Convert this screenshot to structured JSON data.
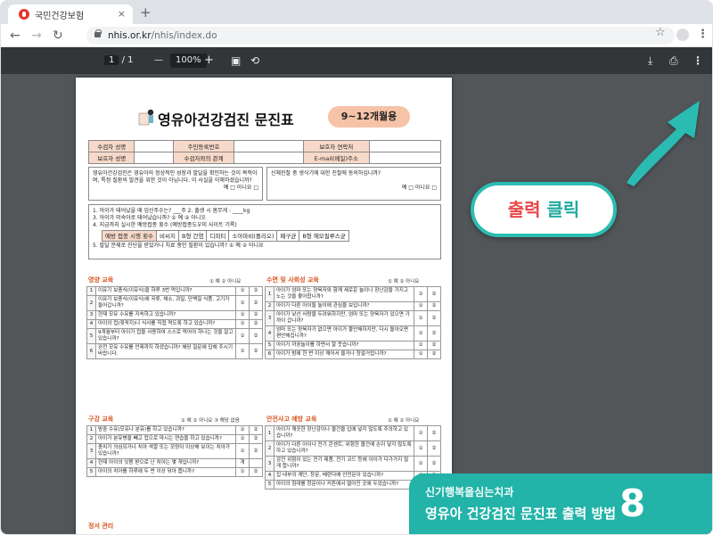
{
  "browser": {
    "tab_title": "국민건강보험",
    "tab_close": "×",
    "new_tab": "+",
    "url_domain": "nhis.or.kr",
    "url_path": "/nhis/index.do",
    "icons": [
      "back-icon",
      "forward-icon",
      "reload-icon",
      "lock-icon",
      "star-icon",
      "profile-icon",
      "menu-icon"
    ]
  },
  "pdf_viewer": {
    "page_current": "1",
    "page_sep": "/",
    "page_total": "1",
    "zoom": "100%",
    "zoom_out": "—",
    "zoom_in": "+",
    "icons": [
      "fit-page-icon",
      "rotate-icon",
      "download-icon",
      "print-icon",
      "more-icon"
    ]
  },
  "document": {
    "title": "영유아건강검진 문진표",
    "age_badge": "9~12개월용",
    "info": {
      "row1": [
        "수검자 성명",
        "",
        "주민등록번호",
        "",
        "보호자 연락처",
        ""
      ],
      "row2": [
        "보호자 성명",
        "",
        "수검자와의 관계",
        "",
        "E-mail(메일)주소",
        ""
      ]
    },
    "consent_left": "영유아건강검진은 영유아의 정상적인 성장과 발달을 확인하는 것이 목적이며, 특정 질환의 발견을 위한 것이 아닙니다. 이 사실을 이해하셨습니까?",
    "consent_left_opts": "예 □   아니요 □",
    "consent_right": "신체진찰 중 생식기에 대한 진찰에 동의하십니까?",
    "consent_right_opts": "예 □   아니요 □",
    "birth_lines": [
      "1. 아이가 태어났을 때 임신주수는? ___주   2. 출생 시 몸무게 : ____kg",
      "3. 아이가 미숙아로 태어났습니까? ① 예  ② 아니오",
      "4. 지금까지 실시한 예방접종 횟수 (예방접종도우미 사이트 기록)",
      "5. 발달 문제로 진단을 받았거나 치료 중인 질환이 있습니까? ① 예  ② 아니요"
    ],
    "vaccines": [
      "비씨지",
      "B형 간염",
      "디피티",
      "소아마비(폴리오)",
      "폐구균",
      "B형 헤모필루스균"
    ],
    "vaccine_label": "예방 접종 시행 횟수",
    "nutrition": {
      "title": "영양 교육",
      "rate": "① 예  ② 아니요",
      "rows": [
        {
          "n": "1",
          "q": "이유기 보충식(이유식)을 하루 3번 먹입니까?",
          "a": "①",
          "b": "②"
        },
        {
          "n": "2",
          "q": "이유기 보충식(이유식)에 곡류, 채소, 과일, 단백질 식품, 고기가 들어갑니까?",
          "a": "①",
          "b": "②"
        },
        {
          "n": "3",
          "q": "현재 모유 수유를 지속하고 있습니까?",
          "a": "①",
          "b": "②"
        },
        {
          "n": "4",
          "q": "아이의 컵(젖꼭지)나 식사를 직접 먹도록 하고 있습니까?",
          "a": "①",
          "b": "②"
        },
        {
          "n": "5",
          "q": "9개월부터 아이가 컵을 사용하여 스스로 먹어야 하나는 것을 알고 있습니까?",
          "a": "①",
          "b": "②"
        },
        {
          "n": "6",
          "q": "완전 모유 수유를 언제까지 하셨습니까? 해당 질문에 답해 주시기 바랍니다.",
          "a": "①",
          "b": "②"
        }
      ]
    },
    "sleep": {
      "title": "수면 및 사회성 교육",
      "rate": "① 예  ② 아니요",
      "rows": [
        {
          "n": "1",
          "q": "아이가 엄마 또는 양육자와 함께 새로운 놀이나 장난감을 가지고 노는 것을 좋아합니까?",
          "a": "①",
          "b": "②"
        },
        {
          "n": "2",
          "q": "아이가 다른 아이들 놀이에 관심을 보입니까?",
          "a": "①",
          "b": "②"
        },
        {
          "n": "3",
          "q": "아이가 낯선 사람을 두려워하지만, 엄마 또는 양육자가 있으면 가까이 갑니까?",
          "a": "①",
          "b": "②"
        },
        {
          "n": "4",
          "q": "엄마 또는 양육자가 없으면 아이가 불안해하지만, 다시 돌아오면 편안해집니까?",
          "a": "①",
          "b": "②"
        },
        {
          "n": "5",
          "q": "아이가 까꿍놀이를 하면서 잘 웃습니까?",
          "a": "①",
          "b": "②"
        },
        {
          "n": "6",
          "q": "아이가 밤에 한 번 이상 깨어서 울거나 칭얼거립니까?",
          "a": "①",
          "b": "②"
        }
      ]
    },
    "oral": {
      "title": "구강 교육",
      "rate": "① 예  ② 아니요  ③ 해당 없음",
      "rows": [
        {
          "n": "1",
          "q": "밤중 수유(모유나 분유)를 하고 있습니까?",
          "a": "①",
          "b": "②"
        },
        {
          "n": "2",
          "q": "아이가 분유병을 빼고 컵으로 마시는 연습을 하고 있습니까?",
          "a": "①",
          "b": "②"
        },
        {
          "n": "3",
          "q": "충치가 의심되거나 치아 색깔 또는 모양이 이상해 보이는 치아가 있습니까?",
          "a": "①",
          "b": "②"
        },
        {
          "n": "4",
          "q": "현재 아이의 잇몸 받으로 난 치아는 몇 개입니까?",
          "a": "개",
          "b": ""
        },
        {
          "n": "5",
          "q": "아이의 치아를 하루에 두 번 이상 닦아 줍니까?",
          "a": "①",
          "b": "②"
        }
      ]
    },
    "safety": {
      "title": "안전사고 예방 교육",
      "rate": "① 예  ② 아니요",
      "rows": [
        {
          "n": "1",
          "q": "아이가 깨끗한 장난감이나 물건을 입에 넣지 않도록 주의하고 있습니까?",
          "a": "①",
          "b": "②"
        },
        {
          "n": "2",
          "q": "아이가 다른 아이나 전기 콘센트, 위험한 물건에 손이 닿지 않도록 하고 있습니까?",
          "a": "①",
          "b": "②"
        },
        {
          "n": "3",
          "q": "감전 위험이 있는 전기 제품, 전기 코드 등에 아이가 다가가지 않게 합니까?",
          "a": "①",
          "b": "②"
        },
        {
          "n": "4",
          "q": "집 내부의 계단, 창문, 베란다에 안전문이 있습니까?",
          "a": "①",
          "b": "②"
        },
        {
          "n": "5",
          "q": "아이의 침대를 창문이나 커튼에서 떨어진 곳에 두었습니까?",
          "a": "①",
          "b": "②"
        }
      ]
    },
    "posture": {
      "title": "정서 관리"
    }
  },
  "callout": {
    "word1": "출력",
    "word2": "클릭"
  },
  "banner": {
    "subtitle": "신기행복을심는치과",
    "title": "영유아 건강검진 문진표 출력 방법",
    "step": "8"
  },
  "colors": {
    "accent_teal": "#23b3a8",
    "callout_red": "#e8474a",
    "section_orange": "#d9541f",
    "header_peach": "#f7d9c9",
    "pdf_dark": "#323639"
  }
}
